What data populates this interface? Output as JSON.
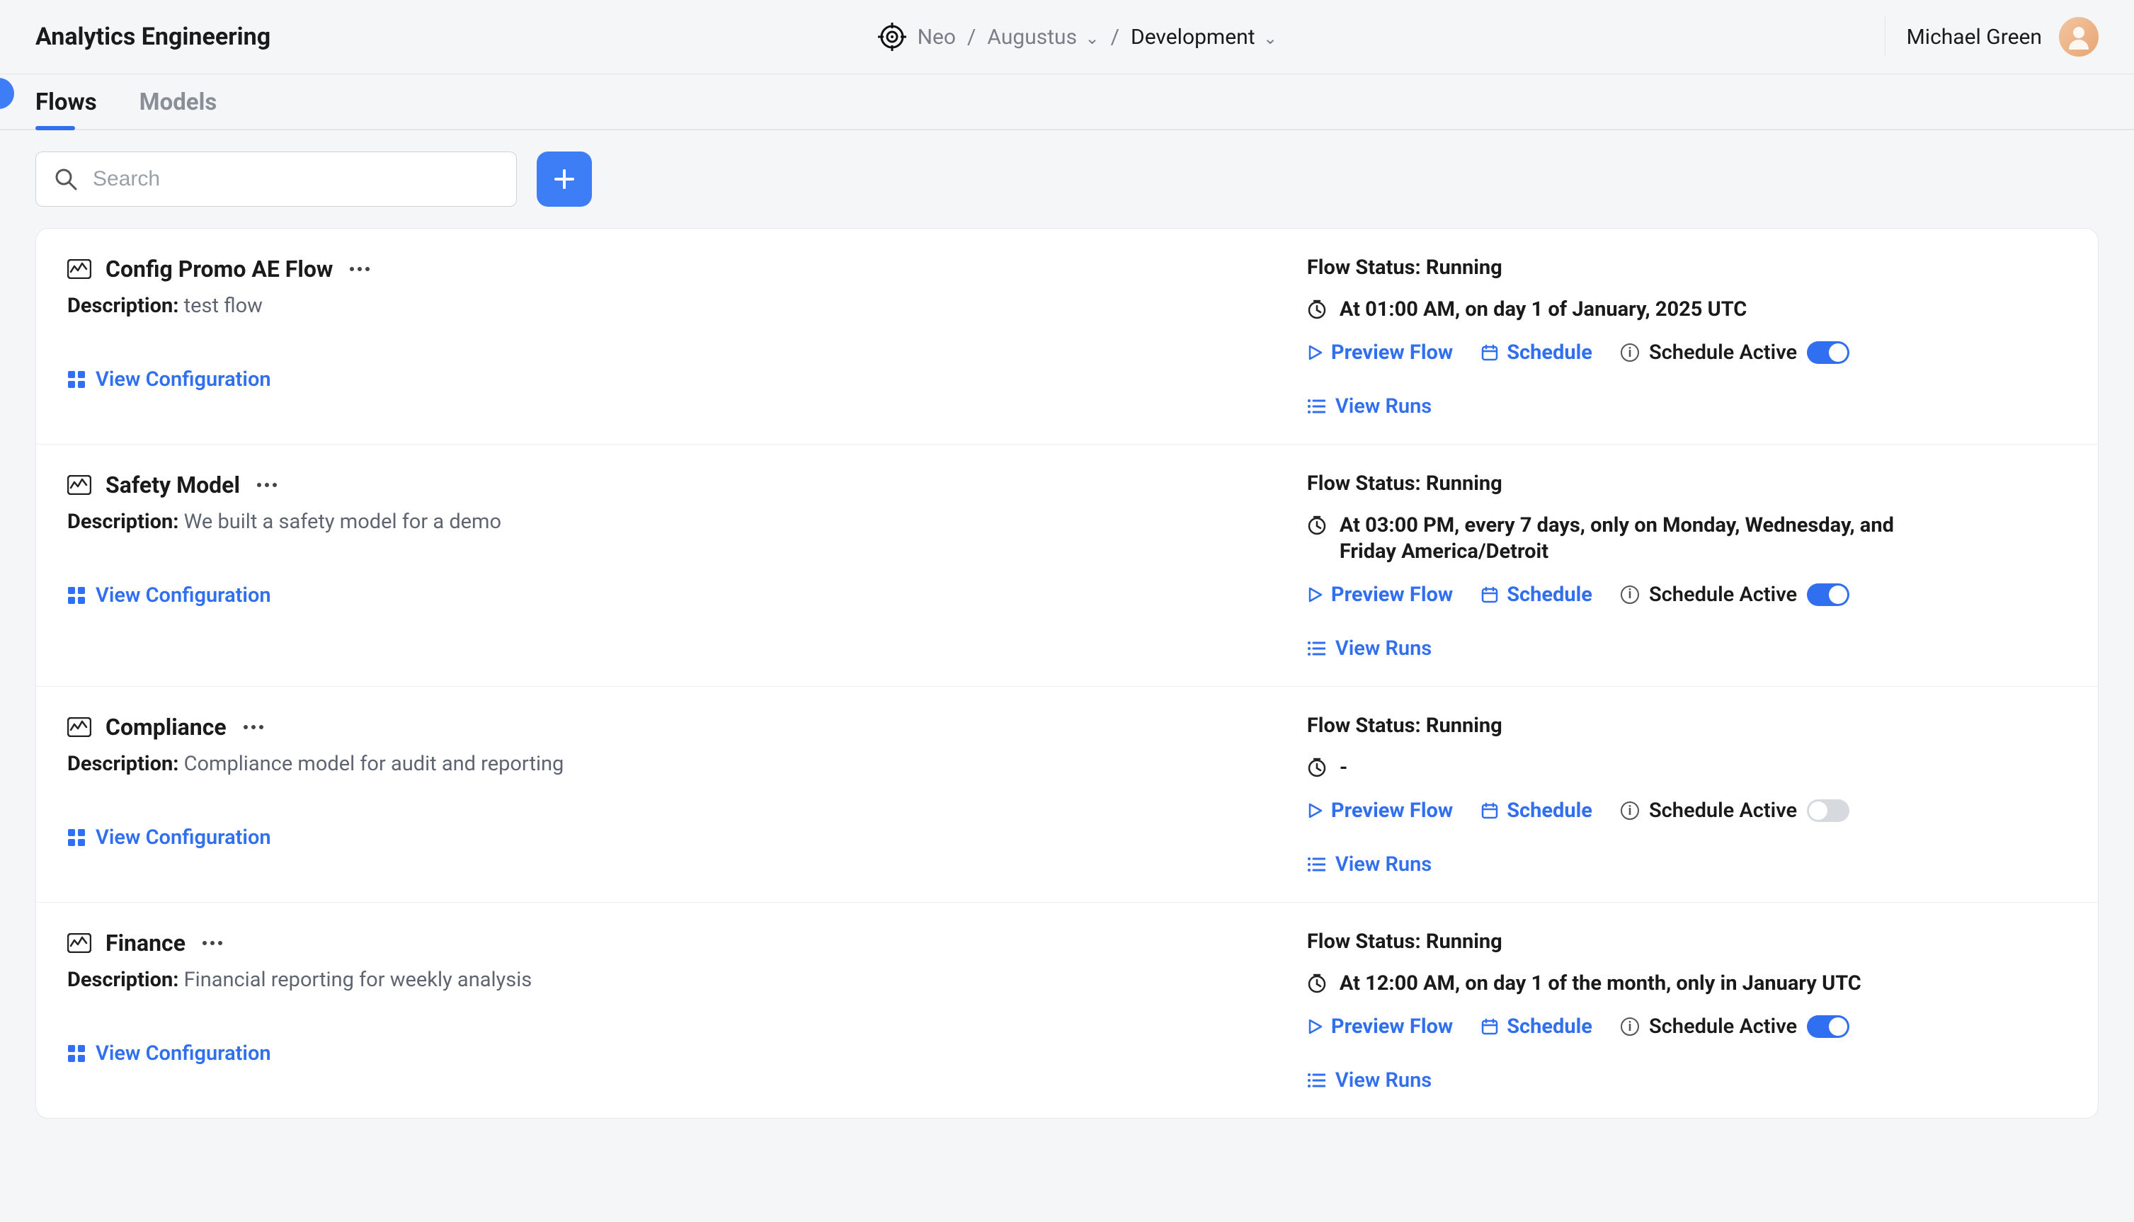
{
  "header": {
    "title": "Analytics Engineering",
    "breadcrumb": {
      "org": "Neo",
      "project": "Augustus",
      "env": "Development"
    },
    "user": "Michael Green"
  },
  "tabs": {
    "flows": "Flows",
    "models": "Models",
    "active": "flows"
  },
  "search": {
    "placeholder": "Search"
  },
  "labels": {
    "description": "Description:",
    "view_config": "View Configuration",
    "preview_flow": "Preview Flow",
    "schedule": "Schedule",
    "schedule_active": "Schedule Active",
    "view_runs": "View Runs",
    "flow_status_prefix": "Flow Status:"
  },
  "flows": [
    {
      "title": "Config Promo AE Flow",
      "description": "test flow",
      "status": "Running",
      "schedule_text": "At 01:00 AM, on day 1 of January, 2025 UTC",
      "schedule_active": true
    },
    {
      "title": "Safety Model",
      "description": "We built a safety model for a demo",
      "status": "Running",
      "schedule_text": "At 03:00 PM, every 7 days, only on Monday, Wednesday, and Friday America/Detroit",
      "schedule_active": true
    },
    {
      "title": "Compliance",
      "description": "Compliance model for audit and reporting",
      "status": "Running",
      "schedule_text": "-",
      "schedule_active": false
    },
    {
      "title": "Finance",
      "description": "Financial reporting for weekly analysis",
      "status": "Running",
      "schedule_text": "At 12:00 AM, on day 1 of the month, only in January UTC",
      "schedule_active": true
    }
  ]
}
